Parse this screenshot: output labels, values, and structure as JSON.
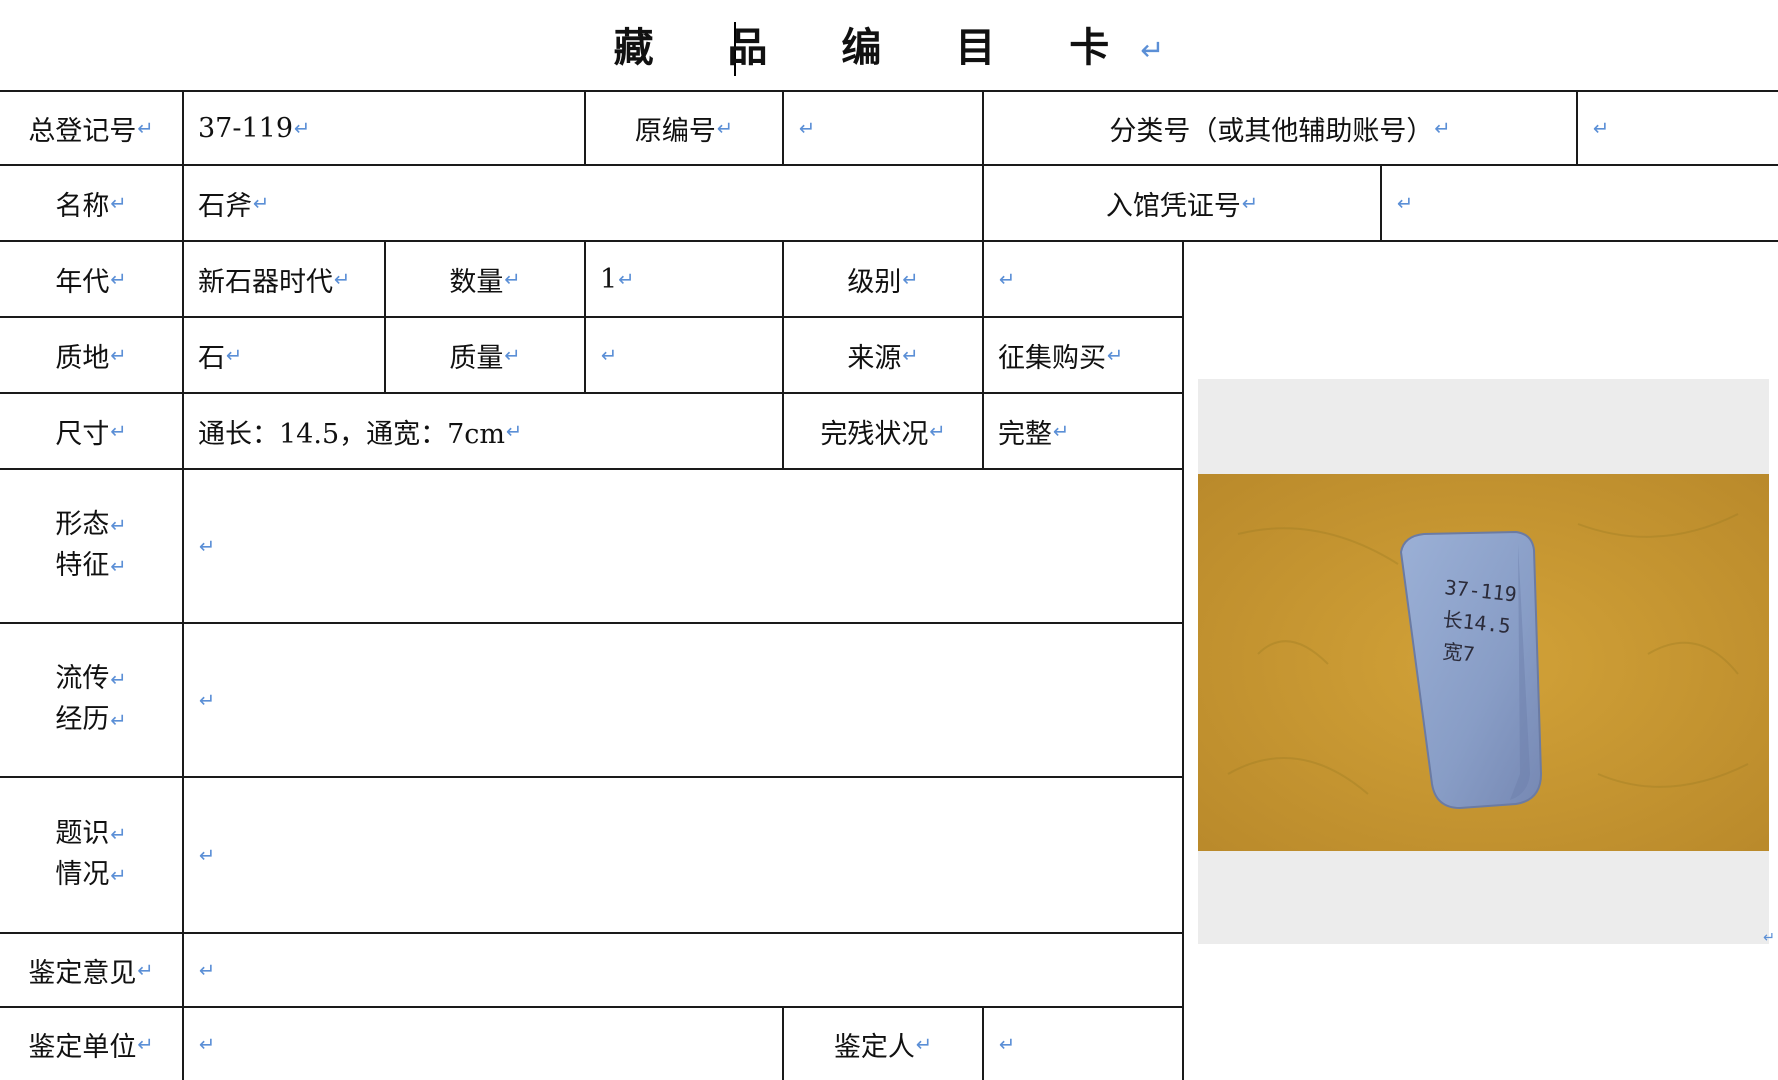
{
  "card": {
    "title": "藏 品 编 目 卡",
    "return_mark": "↵"
  },
  "fields": {
    "reg_no_label": "总登记号",
    "reg_no_value": "37-119",
    "orig_no_label": "原编号",
    "orig_no_value": "",
    "class_no_label": "分类号（或其他辅助账号）",
    "class_no_value": "",
    "name_label": "名称",
    "name_value": "石斧",
    "voucher_label": "入馆凭证号",
    "voucher_value": "",
    "era_label": "年代",
    "era_value": "新石器时代",
    "qty_label": "数量",
    "qty_value": "1",
    "grade_label": "级别",
    "grade_value": "",
    "material_label": "质地",
    "material_value": "石",
    "mass_label": "质量",
    "mass_value": "",
    "source_label": "来源",
    "source_value": "征集购买",
    "size_label": "尺寸",
    "size_value": "通长：14.5，通宽：7cm",
    "condition_label": "完残状况",
    "condition_value": "完整",
    "form_label_1": "形态",
    "form_label_2": "特征",
    "form_value": "",
    "history_label_1": "流传",
    "history_label_2": "经历",
    "history_value": "",
    "inscription_label_1": "题识",
    "inscription_label_2": "情况",
    "inscription_value": "",
    "opinion_label": "鉴定意见",
    "opinion_value": "",
    "unit_label": "鉴定单位",
    "unit_value": "",
    "appraiser_label": "鉴定人",
    "appraiser_value": ""
  },
  "photo": {
    "marking_1": "37-119",
    "marking_2": "长14.5",
    "marking_3": "宽7"
  },
  "colors": {
    "return_mark": "#5b8fd6",
    "photo_background": "#c7972f",
    "stone": "#8fa3c8",
    "grid": "#1a1a1a"
  }
}
